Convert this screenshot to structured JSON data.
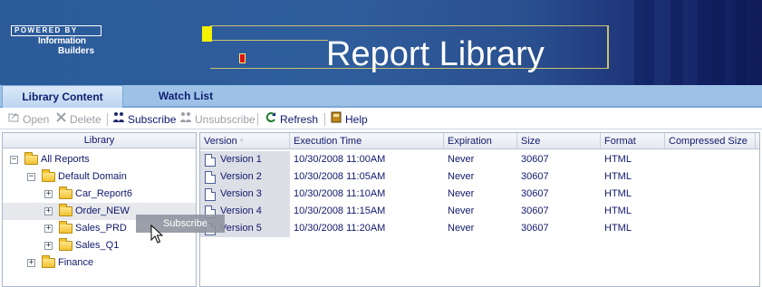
{
  "banner": {
    "powered_by": "POWERED BY",
    "brand_line1": "Information",
    "brand_line2": "Builders",
    "title": "Report Library",
    "colors": {
      "accent_yellow": "#f4f000",
      "accent_red": "#e01010",
      "frame": "#c8c070"
    }
  },
  "tabs": [
    {
      "label": "Library Content",
      "active": true
    },
    {
      "label": "Watch List",
      "active": false
    }
  ],
  "toolbar": {
    "open": {
      "label": "Open",
      "icon": "open-icon",
      "enabled": false
    },
    "delete": {
      "label": "Delete",
      "icon": "delete-icon",
      "enabled": false
    },
    "subscribe": {
      "label": "Subscribe",
      "icon": "subscribe-icon",
      "enabled": true
    },
    "unsubscribe": {
      "label": "Unsubscribe",
      "icon": "unsubscribe-icon",
      "enabled": false
    },
    "refresh": {
      "label": "Refresh",
      "icon": "refresh-icon",
      "enabled": true
    },
    "help": {
      "label": "Help",
      "icon": "help-book-icon",
      "enabled": true
    }
  },
  "library": {
    "header": "Library",
    "tree": [
      {
        "label": "All Reports",
        "expanded": true
      },
      {
        "label": "Default Domain",
        "expanded": true
      },
      {
        "label": "Car_Report6",
        "expanded": false
      },
      {
        "label": "Order_NEW",
        "expanded": false,
        "hovered": true
      },
      {
        "label": "Sales_PRD",
        "expanded": false
      },
      {
        "label": "Sales_Q1",
        "expanded": false
      },
      {
        "label": "Finance",
        "expanded": false
      }
    ]
  },
  "grid": {
    "columns": {
      "version": "Version",
      "execution_time": "Execution Time",
      "expiration": "Expiration",
      "size": "Size",
      "format": "Format",
      "compressed_size": "Compressed Size"
    },
    "sort_indicator": "^",
    "rows": [
      {
        "version": "Version 1",
        "execution_time": "10/30/2008 11:00AM",
        "expiration": "Never",
        "size": "30607",
        "format": "HTML",
        "compressed_size": ""
      },
      {
        "version": "Version 2",
        "execution_time": "10/30/2008 11:05AM",
        "expiration": "Never",
        "size": "30607",
        "format": "HTML",
        "compressed_size": ""
      },
      {
        "version": "Version 3",
        "execution_time": "10/30/2008 11:10AM",
        "expiration": "Never",
        "size": "30607",
        "format": "HTML",
        "compressed_size": ""
      },
      {
        "version": "Version 4",
        "execution_time": "10/30/2008 11:15AM",
        "expiration": "Never",
        "size": "30607",
        "format": "HTML",
        "compressed_size": ""
      },
      {
        "version": "Version 5",
        "execution_time": "10/30/2008 11:20AM",
        "expiration": "Never",
        "size": "30607",
        "format": "HTML",
        "compressed_size": ""
      }
    ]
  },
  "drag_tooltip": "Subscribe"
}
